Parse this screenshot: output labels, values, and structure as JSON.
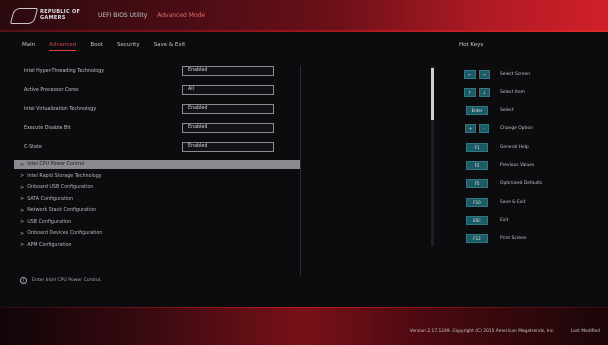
{
  "header": {
    "brand_line1": "REPUBLIC OF",
    "brand_line2": "GAMERS",
    "title": "UEFI BIOS Utility",
    "mode": "Advanced Mode"
  },
  "tabs": [
    {
      "label": "Main"
    },
    {
      "label": "Advanced"
    },
    {
      "label": "Boot"
    },
    {
      "label": "Security"
    },
    {
      "label": "Save & Exit"
    }
  ],
  "options": [
    {
      "label": "Intel Hyper-Threading Technology",
      "value": "Enabled"
    },
    {
      "label": "Active Processor Cores",
      "value": "All"
    },
    {
      "label": "Intel Virtualization Technology",
      "value": "Enabled"
    },
    {
      "label": "Execute Disable Bit",
      "value": "Enabled"
    },
    {
      "label": "C-State",
      "value": "Enabled"
    }
  ],
  "submenus": [
    {
      "label": "Intel CPU Power Control"
    },
    {
      "label": "Intel Rapid Storage Technology"
    },
    {
      "label": "Onboard USB Configuration"
    },
    {
      "label": "SATA Configuration"
    },
    {
      "label": "Network Stack Configuration"
    },
    {
      "label": "USB Configuration"
    },
    {
      "label": "Onboard Devices Configuration"
    },
    {
      "label": "APM Configuration"
    }
  ],
  "info_text": "Enter Intel CPU Power Control.",
  "hotkeys_title": "Hot Keys",
  "hotkeys": [
    {
      "keys": [
        "←",
        "→"
      ],
      "label": "Select Screen"
    },
    {
      "keys": [
        "↑",
        "↓"
      ],
      "label": "Select Item"
    },
    {
      "keys": [
        "Enter"
      ],
      "label": "Select"
    },
    {
      "keys": [
        "+",
        "-"
      ],
      "label": "Change Option"
    },
    {
      "keys": [
        "F1"
      ],
      "label": "General Help"
    },
    {
      "keys": [
        "F2"
      ],
      "label": "Previous Values"
    },
    {
      "keys": [
        "F5"
      ],
      "label": "Optimized Defaults"
    },
    {
      "keys": [
        "F10"
      ],
      "label": "Save & Exit"
    },
    {
      "keys": [
        "ESC"
      ],
      "label": "Exit"
    },
    {
      "keys": [
        "F12"
      ],
      "label": "Print Screen"
    }
  ],
  "footer": {
    "version": "Version 2.17.1249. Copyright (C) 2015 American Megatrends, Inc.",
    "last_modified": "Last Modified"
  }
}
